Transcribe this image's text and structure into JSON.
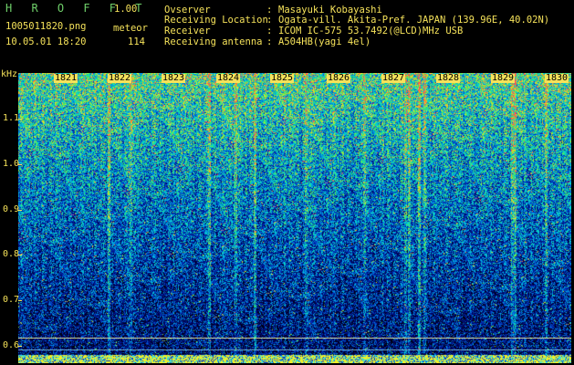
{
  "header": {
    "app_title": "H R O F F T",
    "version": "1.00",
    "filename": "1005011820.png",
    "datetime": "10.05.01 18:20",
    "event_label": "meteor",
    "event_count": "114"
  },
  "info": [
    {
      "key": "Ovserver",
      "sep": ":",
      "value": "Masayuki Kobayashi"
    },
    {
      "key": "Receiving Location",
      "sep": ":",
      "value": "Ogata-vill. Akita-Pref. JAPAN (139.96E, 40.02N)"
    },
    {
      "key": "Receiver",
      "sep": ":",
      "value": "ICOM IC-575 53.7492(@LCD)MHz USB"
    },
    {
      "key": "Receiving antenna",
      "sep": ":",
      "value": "A504HB(yagi 4el)"
    }
  ],
  "spectrogram": {
    "y_unit": "kHz",
    "y_ticks": [
      "1.1",
      "1.0",
      "0.9",
      "0.8",
      "0.7",
      "0.6"
    ],
    "x_ticks": [
      "1821",
      "1822",
      "1823",
      "1824",
      "1825",
      "1826",
      "1827",
      "1828",
      "1829",
      "1830"
    ],
    "colors": {
      "label": "#f5e25a",
      "title": "#6fd06a",
      "reference_line": "#e8e8a0"
    }
  }
}
